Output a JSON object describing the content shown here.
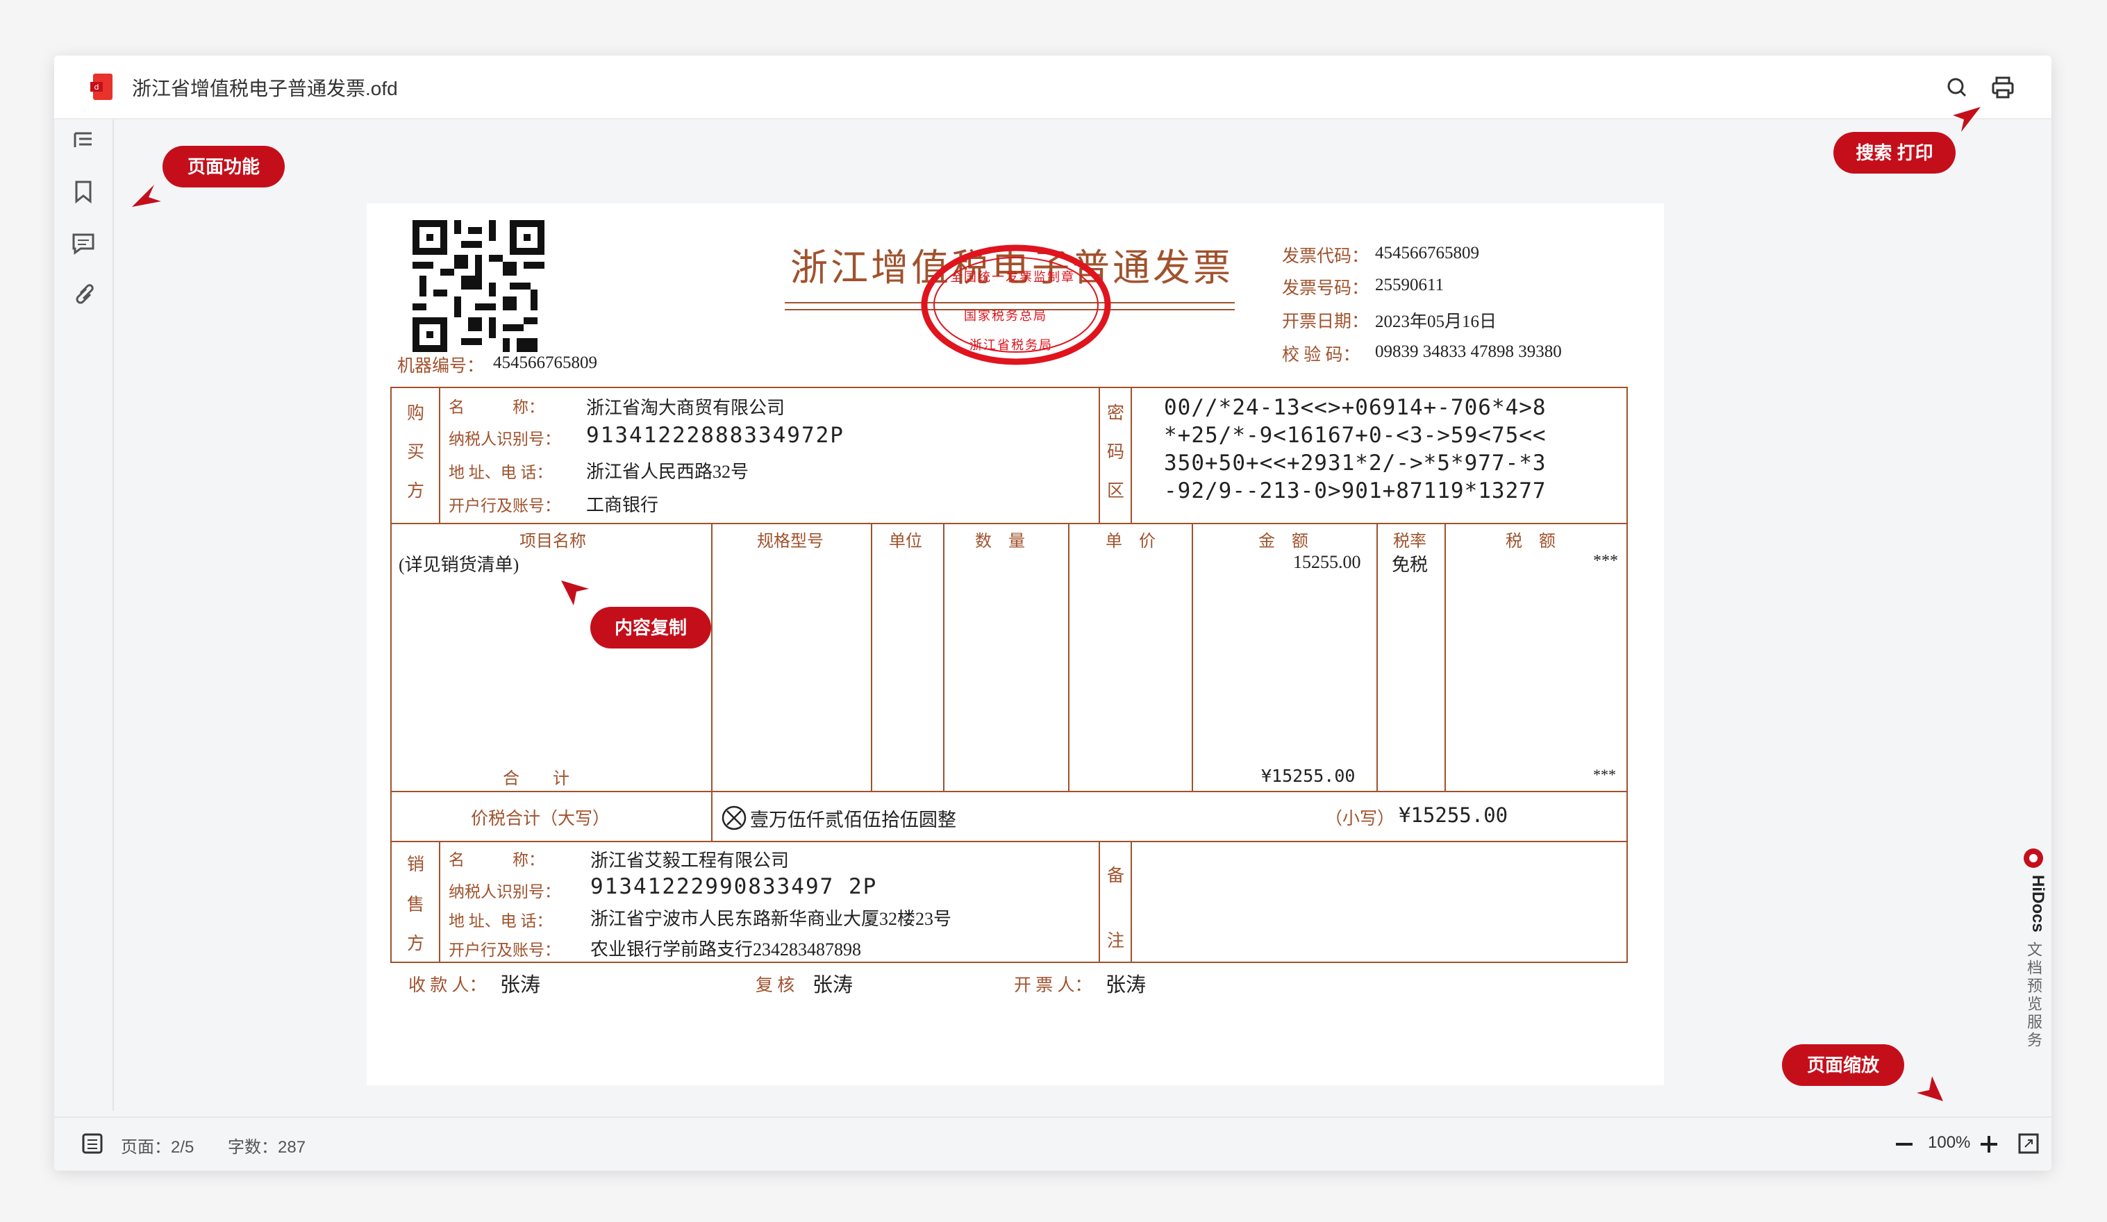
{
  "window": {
    "title": "浙江省增值税电子普通发票.ofd"
  },
  "status": {
    "page": "页面：2/5",
    "words": "字数：287",
    "zoom": "100%"
  },
  "annotations": {
    "page_funcs": "页面功能",
    "search_print": "搜索 打印",
    "copy": "内容复制",
    "zoom": "页面缩放"
  },
  "brand": {
    "name": "HiDocs",
    "desc": "文档预览服务"
  },
  "invoice": {
    "title": "浙江增值税电子普通发票",
    "machine_label": "机器编号：",
    "machine_no": "454566765809",
    "code_label": "发票代码：",
    "code": "454566765809",
    "number_label": "发票号码：",
    "number": "25590611",
    "date_label": "开票日期：",
    "date": "2023年05月16日",
    "check_label": "校 验 码：",
    "check": "09839 34833 47898 39380",
    "stamp_top": "全国统一发票监制章",
    "stamp_mid": "国家税务总局",
    "stamp_bot": "浙江省税务局",
    "buyer": {
      "side": [
        "购",
        "买",
        "方"
      ],
      "name_label": "名　　　称：",
      "name": "浙江省淘大商贸有限公司",
      "tax_label": "纳税人识别号：",
      "tax_id": "91341222888334972P",
      "addr_label": "地 址、电 话：",
      "addr": "浙江省人民西路32号",
      "bank_label": "开户行及账号：",
      "bank": "工商银行"
    },
    "cipher_side": [
      "密",
      "码",
      "区"
    ],
    "cipher": [
      "00//*24-13<<>+06914+-706*4>8",
      "*+25/*-9<16167+0-<3->59<75<<",
      "350+50+<<+2931*2/->*5*977-*3",
      "-92/9--213-0>901+87119*13277"
    ],
    "headers": {
      "item": "项目名称",
      "spec": "规格型号",
      "unit": "单位",
      "qty": "数　量",
      "price": "单　价",
      "amount": "金　额",
      "rate": "税率",
      "tax": "税　额"
    },
    "row": {
      "item": "(详见销货清单)",
      "amount": "15255.00",
      "rate": "免税",
      "tax": "***"
    },
    "total_label": "合　　计",
    "total_amount": "¥15255.00",
    "total_tax": "***",
    "pricetax_label": "价税合计（大写）",
    "pricetax_upper": "壹万伍仟贰佰伍拾伍圆整",
    "pricetax_small_label": "（小写）",
    "pricetax_small": "¥15255.00",
    "seller": {
      "side": [
        "销",
        "售",
        "方"
      ],
      "name_label": "名　　　称：",
      "name": "浙江省艾毅工程有限公司",
      "tax_label": "纳税人识别号：",
      "tax_id": "91341222990833497 2P",
      "addr_label": "地 址、电 话：",
      "addr": "浙江省宁波市人民东路新华商业大厦32楼23号",
      "bank_label": "开户行及账号：",
      "bank": "农业银行学前路支行234283487898"
    },
    "remark_side": [
      "备",
      "注"
    ],
    "payee_label": "收 款 人：",
    "payee": "张涛",
    "reviewer_label": "复 核",
    "reviewer": "张涛",
    "drawer_label": "开 票 人：",
    "drawer": "张涛"
  },
  "colors": {
    "accent": "#c40f1b",
    "invoice_brown": "#a0522d"
  }
}
